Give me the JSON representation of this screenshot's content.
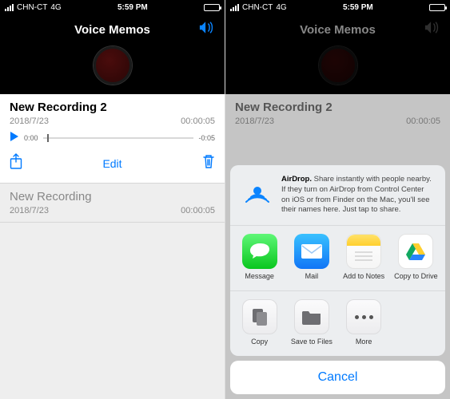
{
  "status": {
    "carrier": "CHN-CT",
    "network": "4G",
    "time": "5:59 PM"
  },
  "header": {
    "title": "Voice Memos"
  },
  "recordings": {
    "expanded": {
      "title": "New Recording 2",
      "date": "2018/7/23",
      "duration": "00:00:05",
      "playTimeStart": "0:00",
      "playTimeEnd": "-0:05"
    },
    "other": {
      "title": "New Recording",
      "date": "2018/7/23",
      "duration": "00:00:05"
    }
  },
  "actions": {
    "edit": "Edit"
  },
  "airdrop": {
    "bold": "AirDrop.",
    "text": "Share instantly with people nearby. If they turn on AirDrop from Control Center on iOS or from Finder on the Mac, you'll see their names here. Just tap to share."
  },
  "share": {
    "message": "Message",
    "mail": "Mail",
    "notes": "Add to Notes",
    "drive": "Copy to Drive",
    "copy": "Copy",
    "saveToFiles": "Save to Files",
    "more": "More"
  },
  "cancel": "Cancel"
}
